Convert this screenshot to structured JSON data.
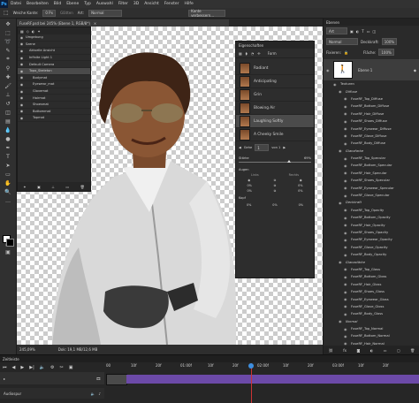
{
  "app": {
    "logo": "Ps"
  },
  "menu": [
    "Datei",
    "Bearbeiten",
    "Bild",
    "Ebene",
    "Typ",
    "Auswahl",
    "Filter",
    "3D",
    "Ansicht",
    "Fenster",
    "Hilfe"
  ],
  "options": {
    "soft_edge_label": "Weiche Kante:",
    "soft_edge_value": "0 Px",
    "smoothing": "Glätten",
    "style_label": "Art:",
    "style_value": "Normal",
    "refine_button": "Kante verbessern..."
  },
  "document": {
    "tab_title": "FuseRF.psd bei 245% (Ebene 1, RGB/8*)"
  },
  "scene": {
    "items": [
      {
        "label": "Umgebung"
      },
      {
        "label": "Szene"
      },
      {
        "label": "Aktuelle Ansicht"
      },
      {
        "label": "Infinite Light 1"
      },
      {
        "label": "Default Camera"
      },
      {
        "label": "Topo_Skeleton"
      },
      {
        "label": "Bodymat"
      },
      {
        "label": "Eyewear_mat"
      },
      {
        "label": "Glovemat"
      },
      {
        "label": "Hairmat"
      },
      {
        "label": "Shoesmat"
      },
      {
        "label": "Bottommat"
      },
      {
        "label": "Topmat"
      }
    ],
    "selected_index": 5
  },
  "properties": {
    "title": "Eigenschaften",
    "tab_label": "Form",
    "morphs": [
      "Radiant",
      "Anticipating",
      "Grin",
      "Blowing Air",
      "Laughing Softly",
      "A Cheeky Smile"
    ],
    "selected_morph": 4,
    "strength_label": "Stärke",
    "strength_value": "69%",
    "frame_label": "Gehe",
    "frame_value": "1",
    "frame_of": "von 1",
    "eyes_label": "Augen",
    "left_label": "Links",
    "right_label": "Rechts",
    "head_label": "Kopf",
    "vals": [
      "0%",
      "0%",
      "0%",
      "0%",
      "0%",
      "0%",
      "0%"
    ]
  },
  "layers": {
    "tab_label": "Ebenen",
    "kind_label": "Art",
    "blend_mode": "Normal",
    "opacity_label": "Deckkraft:",
    "opacity_value": "100%",
    "fill_label": "Fläche:",
    "fill_value": "100%",
    "fix_label": "Fixieren:",
    "layer_name": "Ebene 1",
    "textures_label": "Texturen",
    "textures": [
      {
        "label": "Diffuse",
        "group": true
      },
      {
        "label": "FuseRF_Top_Diffuse"
      },
      {
        "label": "FuseRF_Bottom_Diffuse"
      },
      {
        "label": "FuseRF_Hair_Diffuse"
      },
      {
        "label": "FuseRF_Shoes_Diffuse"
      },
      {
        "label": "FuseRF_Eyewear_Diffuse"
      },
      {
        "label": "FuseRF_Glove_Diffuse"
      },
      {
        "label": "FuseRF_Body_Diffuse"
      },
      {
        "label": "Glanzfarbe",
        "group": true
      },
      {
        "label": "FuseRF_Top_Specular"
      },
      {
        "label": "FuseRF_Bottom_Specular"
      },
      {
        "label": "FuseRF_Hair_Specular"
      },
      {
        "label": "FuseRF_Shoes_Specular"
      },
      {
        "label": "FuseRF_Eyewear_Specular"
      },
      {
        "label": "FuseRF_Glove_Specular"
      },
      {
        "label": "Deckkraft",
        "group": true
      },
      {
        "label": "FuseRF_Top_Opacity"
      },
      {
        "label": "FuseRF_Bottom_Opacity"
      },
      {
        "label": "FuseRF_Hair_Opacity"
      },
      {
        "label": "FuseRF_Shoes_Opacity"
      },
      {
        "label": "FuseRF_Eyewear_Opacity"
      },
      {
        "label": "FuseRF_Glove_Opacity"
      },
      {
        "label": "FuseRF_Body_Opacity"
      },
      {
        "label": "Glanzstärke",
        "group": true
      },
      {
        "label": "FuseRF_Top_Gloss"
      },
      {
        "label": "FuseRF_Bottom_Gloss"
      },
      {
        "label": "FuseRF_Hair_Gloss"
      },
      {
        "label": "FuseRF_Shoes_Gloss"
      },
      {
        "label": "FuseRF_Eyewear_Gloss"
      },
      {
        "label": "FuseRF_Glove_Gloss"
      },
      {
        "label": "FuseRF_Body_Gloss"
      },
      {
        "label": "Normal",
        "group": true
      },
      {
        "label": "FuseRF_Top_Normal"
      },
      {
        "label": "FuseRF_Bottom_Normal"
      },
      {
        "label": "FuseRF_Hair_Normal"
      },
      {
        "label": "FuseRF_Shoes_Normal"
      },
      {
        "label": "FuseRF_Eyewear_Normal"
      },
      {
        "label": "FuseRF_Glove_Normal"
      },
      {
        "label": "FuseRF_Body_Normal"
      }
    ]
  },
  "status": {
    "zoom": "245,09%",
    "docsize": "Dok: 19,1 MB/12,6 MB"
  },
  "timeline": {
    "title": "Zeitleiste",
    "ticks": [
      "00",
      "10f",
      "20f",
      "01:00f",
      "10f",
      "20f",
      "02:00f",
      "10f",
      "20f",
      "03:00f",
      "10f",
      "20f"
    ],
    "audio_label": "Audiospur",
    "playhead_time": "01:00f"
  },
  "colors": {
    "accent": "#31a8ff",
    "timeline_clip": "#6c4aa8",
    "playhead": "#3e8fe0"
  }
}
